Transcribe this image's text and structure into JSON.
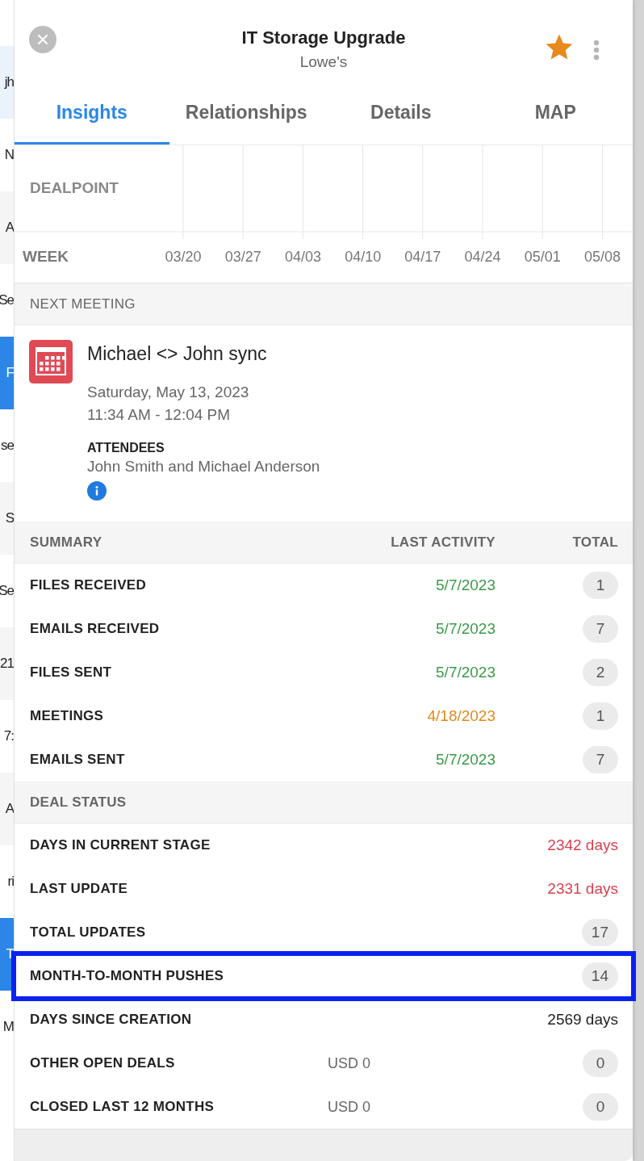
{
  "background_list": [
    {
      "text": "jh",
      "selected": false,
      "highlighted": true
    },
    {
      "text": "N",
      "selected": false,
      "highlighted": false
    },
    {
      "text": "A",
      "selected": false,
      "highlighted": false
    },
    {
      "text": "Se",
      "selected": false,
      "highlighted": false
    },
    {
      "text": "F",
      "selected": true,
      "highlighted": false
    },
    {
      "text": "se",
      "selected": false,
      "highlighted": false
    },
    {
      "text": "S",
      "selected": false,
      "highlighted": false
    },
    {
      "text": "Se",
      "selected": false,
      "highlighted": false
    },
    {
      "text": "21",
      "selected": false,
      "highlighted": false
    },
    {
      "text": "7:",
      "selected": false,
      "highlighted": false
    },
    {
      "text": "A",
      "selected": false,
      "highlighted": false
    },
    {
      "text": "ri",
      "selected": false,
      "highlighted": false
    },
    {
      "text": "T",
      "selected": true,
      "highlighted": false
    },
    {
      "text": "M",
      "selected": false,
      "highlighted": false
    }
  ],
  "header": {
    "title": "IT Storage Upgrade",
    "subtitle": "Lowe's",
    "starred": true
  },
  "tabs": [
    {
      "label": "Insights",
      "selected": true
    },
    {
      "label": "Relationships",
      "selected": false
    },
    {
      "label": "Details",
      "selected": false
    },
    {
      "label": "MAP",
      "selected": false
    }
  ],
  "activity_timeline": {
    "rows": [
      "DEALPOINT"
    ],
    "axis_label": "WEEK",
    "weeks": [
      "03/20",
      "03/27",
      "04/03",
      "04/10",
      "04/17",
      "04/24",
      "05/01",
      "05/08"
    ]
  },
  "next_meeting": {
    "heading": "NEXT MEETING",
    "title": "Michael <> John sync",
    "date": "Saturday, May 13, 2023",
    "time": "11:34 AM - 12:04 PM",
    "attendees_label": "ATTENDEES",
    "attendees": "John Smith and Michael Anderson"
  },
  "summary": {
    "columns": [
      "SUMMARY",
      "LAST ACTIVITY",
      "TOTAL"
    ],
    "rows": [
      {
        "label": "FILES RECEIVED",
        "last_activity": "5/7/2023",
        "color": "#3a9a48",
        "total": "1"
      },
      {
        "label": "EMAILS RECEIVED",
        "last_activity": "5/7/2023",
        "color": "#3a9a48",
        "total": "7"
      },
      {
        "label": "FILES SENT",
        "last_activity": "5/7/2023",
        "color": "#3a9a48",
        "total": "2"
      },
      {
        "label": "MEETINGS",
        "last_activity": "4/18/2023",
        "color": "#e0891e",
        "total": "1"
      },
      {
        "label": "EMAILS SENT",
        "last_activity": "5/7/2023",
        "color": "#3a9a48",
        "total": "7"
      }
    ]
  },
  "deal_status": {
    "heading": "DEAL STATUS",
    "rows": [
      {
        "label": "DAYS IN CURRENT STAGE",
        "value": "2342 days",
        "color": "#d9414f",
        "highlighted": false
      },
      {
        "label": "LAST UPDATE",
        "value": "2331 days",
        "color": "#d9414f",
        "highlighted": false
      },
      {
        "label": "TOTAL UPDATES",
        "total": "17",
        "highlighted": false
      },
      {
        "label": "MONTH-TO-MONTH PUSHES",
        "total": "14",
        "highlighted": true
      },
      {
        "label": "DAYS SINCE CREATION",
        "value": "2569 days",
        "color": "#222222",
        "highlighted": false
      },
      {
        "label": "OTHER OPEN DEALS",
        "amount": "USD 0",
        "total": "0",
        "highlighted": false
      },
      {
        "label": "CLOSED LAST 12 MONTHS",
        "amount": "USD 0",
        "total": "0",
        "highlighted": false
      }
    ]
  }
}
